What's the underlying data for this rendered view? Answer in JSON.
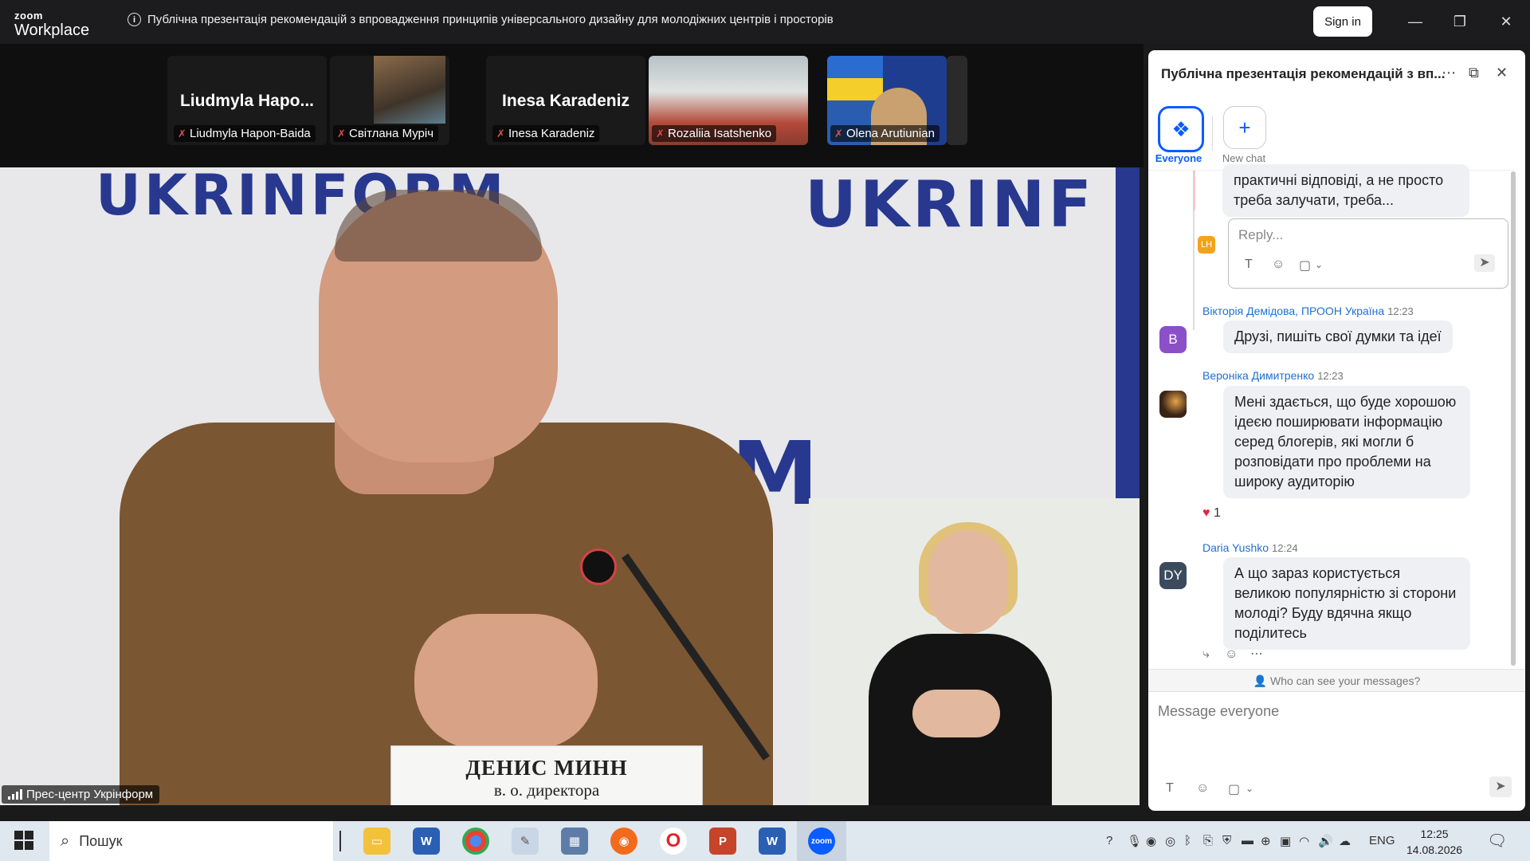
{
  "titlebar": {
    "logo_top": "zoom",
    "logo_bottom": "Workplace",
    "meeting_title": "Публічна презентація рекомендацій з впровадження принципів універсального дизайну для молодіжних центрів і просторів",
    "signin_label": "Sign in"
  },
  "participants": [
    {
      "big_name": "Liudmyla  Hapo...",
      "tag": "Liudmyla Hapon-Baida"
    },
    {
      "tag": "Світлана Муріч"
    },
    {
      "big_name": "Inesa Karadeniz",
      "tag": "Inesa Karadeniz"
    },
    {
      "tag": "Rozaliia Isatshenko"
    },
    {
      "tag": "Olena Arutiunian"
    }
  ],
  "main_video": {
    "wall_text_top": "UKRINFORM",
    "wall_text_right": "UKRINF",
    "wall_text_mid": "UKRINFORM",
    "nameplate_line1": "ДЕНИС МИНН",
    "nameplate_line2": "в. о. директора",
    "source_label": "Прес-центр Укрінформ"
  },
  "chat": {
    "header_title": "Публічна презентація рекомендацій з вп...",
    "tab_everyone": "Everyone",
    "tab_new_chat": "New chat",
    "prev_message": "практичні відповіді, а не просто\nтреба залучати, треба...",
    "reply_avatar": "LH",
    "reply_placeholder": "Reply...",
    "messages": [
      {
        "avatar": "В",
        "sender": "Вікторія Демідова, ПРООН Україна",
        "time": "12:23",
        "text": "Друзі, пишіть свої думки та ідеї"
      },
      {
        "avatar": "",
        "sender": "Вероніка Димитренко",
        "time": "12:23",
        "text": "Мені здається, що буде хорошою ідеєю поширювати інформацію серед блогерів, які могли б розповідати про проблеми на широку аудиторію",
        "reaction_count": "1"
      },
      {
        "avatar": "DY",
        "sender": "Daria Yushko",
        "time": "12:24",
        "text": "А що зараз користується великою популярністю зі сторони молоді? Буду вдячна якщо поділитесь"
      }
    ],
    "visibility_notice": "Who can see your messages?",
    "compose_placeholder": "Message everyone"
  },
  "taskbar": {
    "search_placeholder": "Пошук",
    "language": "ENG",
    "time": "12:25",
    "date": "14.08.2026"
  },
  "colors": {
    "zoom_blue": "#0b5cff",
    "mute_red": "#e24c4c",
    "chat_bubble": "#eef0f3",
    "sender_blue": "#1f6fd1"
  }
}
